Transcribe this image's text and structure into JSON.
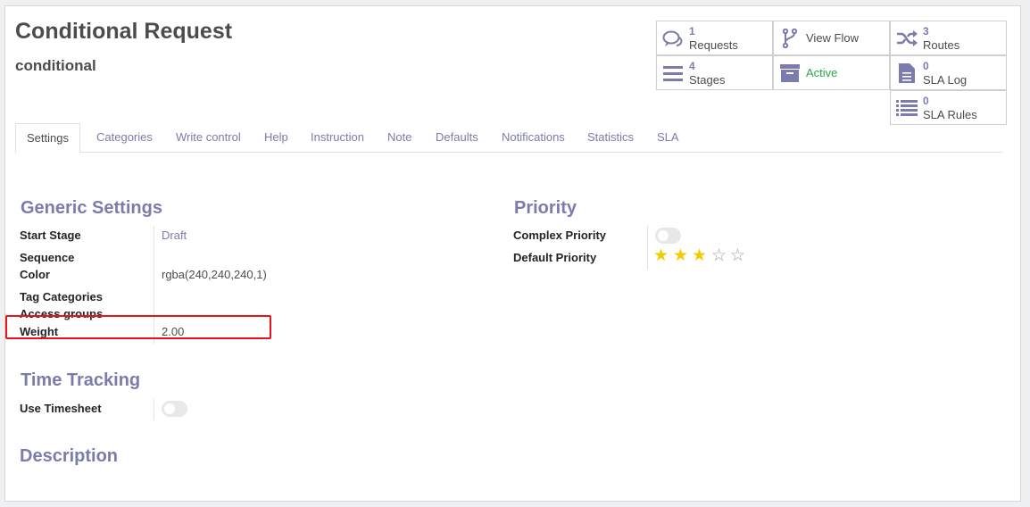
{
  "record": {
    "title": "Conditional Request",
    "subtitle": "conditional"
  },
  "stats": {
    "requests": {
      "count": "1",
      "label": "Requests",
      "icon": "comments-icon"
    },
    "view_flow": {
      "label": "View Flow",
      "icon": "code-fork-icon"
    },
    "routes": {
      "count": "3",
      "label": "Routes",
      "icon": "shuffle-icon"
    },
    "stages": {
      "count": "4",
      "label": "Stages",
      "icon": "bars-icon"
    },
    "active": {
      "label": "Active",
      "icon": "archive-icon",
      "color": "#28a745"
    },
    "sla_log": {
      "count": "0",
      "label": "SLA Log",
      "icon": "file-text-icon"
    },
    "sla_rules": {
      "count": "0",
      "label": "SLA Rules",
      "icon": "list-icon"
    }
  },
  "tabs": [
    "Settings",
    "Categories",
    "Write control",
    "Help",
    "Instruction",
    "Note",
    "Defaults",
    "Notifications",
    "Statistics",
    "SLA"
  ],
  "generic_settings": {
    "heading": "Generic Settings",
    "start_stage": {
      "label": "Start Stage",
      "value": "Draft"
    },
    "sequence": {
      "label": "Sequence"
    },
    "color": {
      "label": "Color",
      "value": "rgba(240,240,240,1)"
    },
    "tag_categories": {
      "label": "Tag Categories"
    },
    "access_groups": {
      "label": "Access groups"
    },
    "weight": {
      "label": "Weight",
      "value": "2.00"
    }
  },
  "priority": {
    "heading": "Priority",
    "complex_priority": {
      "label": "Complex Priority",
      "enabled": false
    },
    "default_priority": {
      "label": "Default Priority",
      "stars_filled": 3,
      "stars_total": 5
    }
  },
  "time_tracking": {
    "heading": "Time Tracking",
    "use_timesheet": {
      "label": "Use Timesheet",
      "enabled": false
    }
  },
  "description": {
    "heading": "Description"
  },
  "colors": {
    "accent": "#7c7bad",
    "highlight": "#e8141a",
    "star": "#f3cc00"
  }
}
